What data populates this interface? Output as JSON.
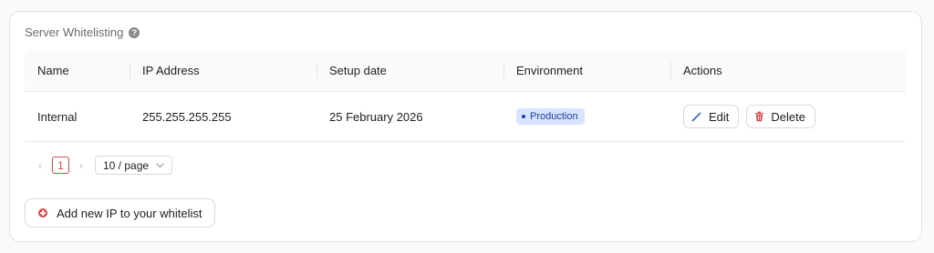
{
  "card": {
    "title": "Server Whitelisting",
    "help_icon": "question-circle-icon"
  },
  "table": {
    "headers": [
      "Name",
      "IP Address",
      "Setup date",
      "Environment",
      "Actions"
    ],
    "rows": [
      {
        "name": "Internal",
        "ip": "255.255.255.255",
        "setup_date": "25 February 2026",
        "environment": "Production",
        "edit_label": "Edit",
        "delete_label": "Delete"
      }
    ]
  },
  "pagination": {
    "prev_icon": "chevron-left-icon",
    "current_page": "1",
    "next_icon": "chevron-right-icon",
    "page_size": "10 / page",
    "page_size_icon": "chevron-down-icon"
  },
  "add_button": {
    "label": "Add new IP to your whitelist",
    "icon": "plus-circle-icon"
  },
  "colors": {
    "accent_red": "#d94c4c",
    "badge_bg": "#d8e4ff",
    "badge_text": "#1d3f9e",
    "edit_icon": "#2f5bd3"
  }
}
